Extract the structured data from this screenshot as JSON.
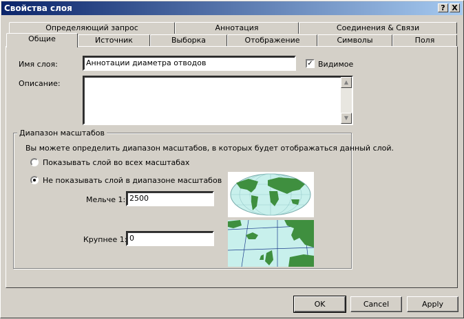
{
  "window": {
    "title": "Свойства слоя",
    "help_label": "?",
    "close_label": "X"
  },
  "tabs_row1": [
    {
      "label": "Определяющий запрос"
    },
    {
      "label": "Аннотация"
    },
    {
      "label": "Соединения & Связи"
    }
  ],
  "tabs_row2": [
    {
      "label": "Общие",
      "active": true
    },
    {
      "label": "Источник"
    },
    {
      "label": "Выборка"
    },
    {
      "label": "Отображение"
    },
    {
      "label": "Символы"
    },
    {
      "label": "Поля"
    }
  ],
  "general": {
    "layer_name_label": "Имя слоя:",
    "layer_name_value": "Аннотации диаметра отводов",
    "visible_label": "Видимое",
    "visible_checked": true,
    "description_label": "Описание:",
    "description_value": ""
  },
  "scale_range": {
    "group_title": "Диапазон масштабов",
    "info": "Вы можете определить диапазон масштабов, в которых будет отображаться данный слой.",
    "option_all": "Показывать слой во всех масштабах",
    "option_range": "Не показывать слой в диапазоне масштабов",
    "selected": "range",
    "min_label": "Мельче 1:",
    "min_value": "2500",
    "max_label": "Крупнее 1:",
    "max_value": "0"
  },
  "buttons": {
    "ok": "OK",
    "cancel": "Cancel",
    "apply": "Apply"
  },
  "colors": {
    "titlebar_start": "#0a246a",
    "titlebar_end": "#a6caf0",
    "face": "#d4d0c8",
    "land": "#3f8f3f",
    "sea": "#c8f0ec"
  }
}
